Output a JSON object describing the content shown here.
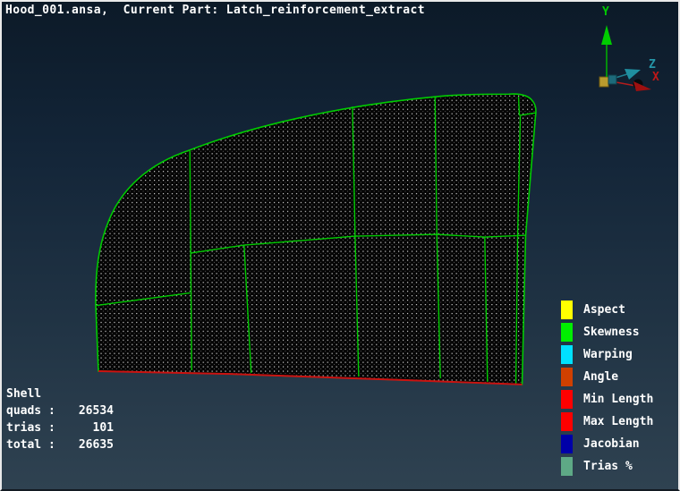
{
  "title": "Hood_001.ansa,  Current Part: Latch_reinforcement_extract",
  "axis_triad": {
    "x_label": "X",
    "y_label": "Y",
    "z_label": "Z"
  },
  "legend": {
    "items": [
      {
        "label": "Aspect",
        "color": "#ffff00"
      },
      {
        "label": "Skewness",
        "color": "#00ee00"
      },
      {
        "label": "Warping",
        "color": "#00e1ff"
      },
      {
        "label": "Angle",
        "color": "#d04000"
      },
      {
        "label": "Min Length",
        "color": "#ff0000"
      },
      {
        "label": "Max Length",
        "color": "#ff0000"
      },
      {
        "label": "Jacobian",
        "color": "#0000a8"
      },
      {
        "label": "Trias %",
        "color": "#5ea986"
      }
    ]
  },
  "stats": {
    "title": "Shell",
    "rows": [
      {
        "label": "quads :",
        "value": "26534"
      },
      {
        "label": "trias :",
        "value": "101"
      },
      {
        "label": "total :",
        "value": "26635"
      }
    ]
  },
  "colors": {
    "mesh_edge": "#00cc00",
    "free_edge": "#cc1111",
    "axis_x": "#c01818",
    "axis_y": "#00cc00",
    "axis_z": "#2596a8",
    "background_top": "#0c1a28",
    "background_bottom": "#2f4251"
  }
}
